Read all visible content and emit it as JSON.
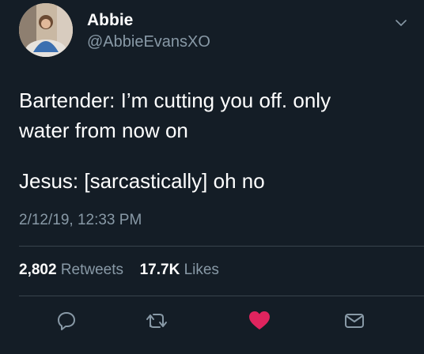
{
  "user": {
    "display_name": "Abbie",
    "handle": "@AbbieEvansXO"
  },
  "tweet": {
    "lines": [
      "Bartender: I’m cutting you off. only",
      "water from now on",
      "Jesus: [sarcastically] oh no"
    ],
    "timestamp": "2/12/19, 12:33 PM"
  },
  "stats": {
    "retweets_count": "2,802",
    "retweets_label": "Retweets",
    "likes_count": "17.7K",
    "likes_label": "Likes"
  },
  "icons": {
    "menu": "chevron-down-icon",
    "reply": "reply-icon",
    "retweet": "retweet-icon",
    "like": "heart-icon",
    "share": "mail-icon"
  },
  "colors": {
    "background": "#141d26",
    "text": "#ffffff",
    "secondary_text": "#8899a6",
    "divider": "#38444d",
    "like_active": "#e0245e"
  }
}
